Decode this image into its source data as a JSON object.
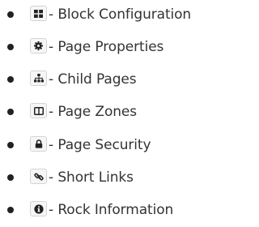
{
  "legend": {
    "items": [
      {
        "icon": "th-large-icon",
        "label": "- Block Configuration"
      },
      {
        "icon": "cog-icon",
        "label": "- Page Properties"
      },
      {
        "icon": "sitemap-icon",
        "label": "- Child Pages"
      },
      {
        "icon": "columns-icon",
        "label": "- Page Zones"
      },
      {
        "icon": "lock-icon",
        "label": "- Page Security"
      },
      {
        "icon": "link-icon",
        "label": "- Short Links"
      },
      {
        "icon": "info-circle-icon",
        "label": "- Rock Information"
      }
    ]
  }
}
